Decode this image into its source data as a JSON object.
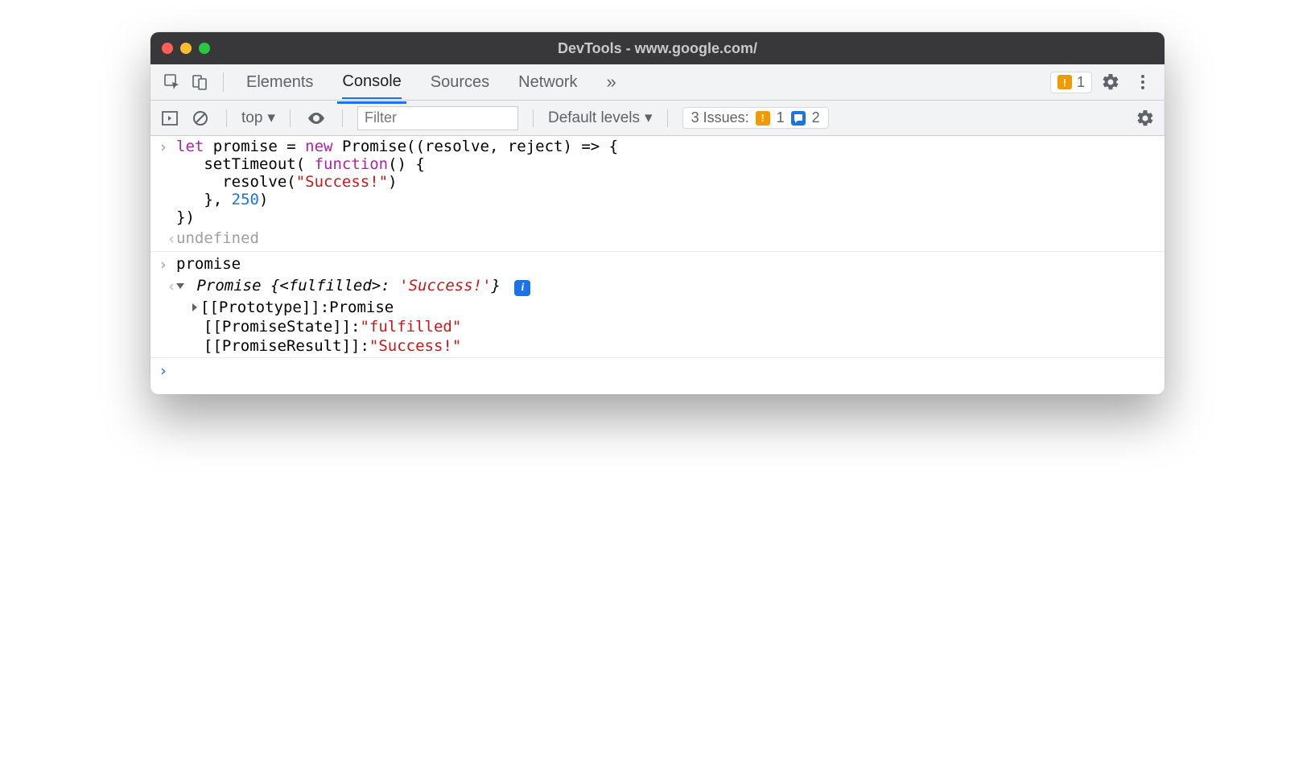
{
  "window": {
    "title": "DevTools - www.google.com/"
  },
  "tabs": {
    "elements": "Elements",
    "console": "Console",
    "sources": "Sources",
    "network": "Network"
  },
  "tabbar": {
    "warning_count": "1"
  },
  "toolbar": {
    "context": "top",
    "filter_placeholder": "Filter",
    "levels": "Default levels",
    "issues_label": "3 Issues:",
    "issues_warn": "1",
    "issues_info": "2"
  },
  "console": {
    "input1": {
      "l1a": "let",
      "l1b": " promise = ",
      "l1c": "new",
      "l1d": " Promise((resolve, reject) => {",
      "l2a": "   setTimeout( ",
      "l2b": "function",
      "l2c": "() {",
      "l3a": "     resolve(",
      "l3b": "\"Success!\"",
      "l3c": ")",
      "l4a": "   }, ",
      "l4b": "250",
      "l4c": ")",
      "l5": "})"
    },
    "out1": "undefined",
    "input2": "promise",
    "summary": {
      "pre": "Promise {",
      "state": "<fulfilled>",
      "colon": ": ",
      "value": "'Success!'",
      "post": "}"
    },
    "props": {
      "proto_key": "[[Prototype]]",
      "proto_val": "Promise",
      "state_key": "[[PromiseState]]",
      "state_val": "\"fulfilled\"",
      "result_key": "[[PromiseResult]]",
      "result_val": "\"Success!\""
    }
  }
}
